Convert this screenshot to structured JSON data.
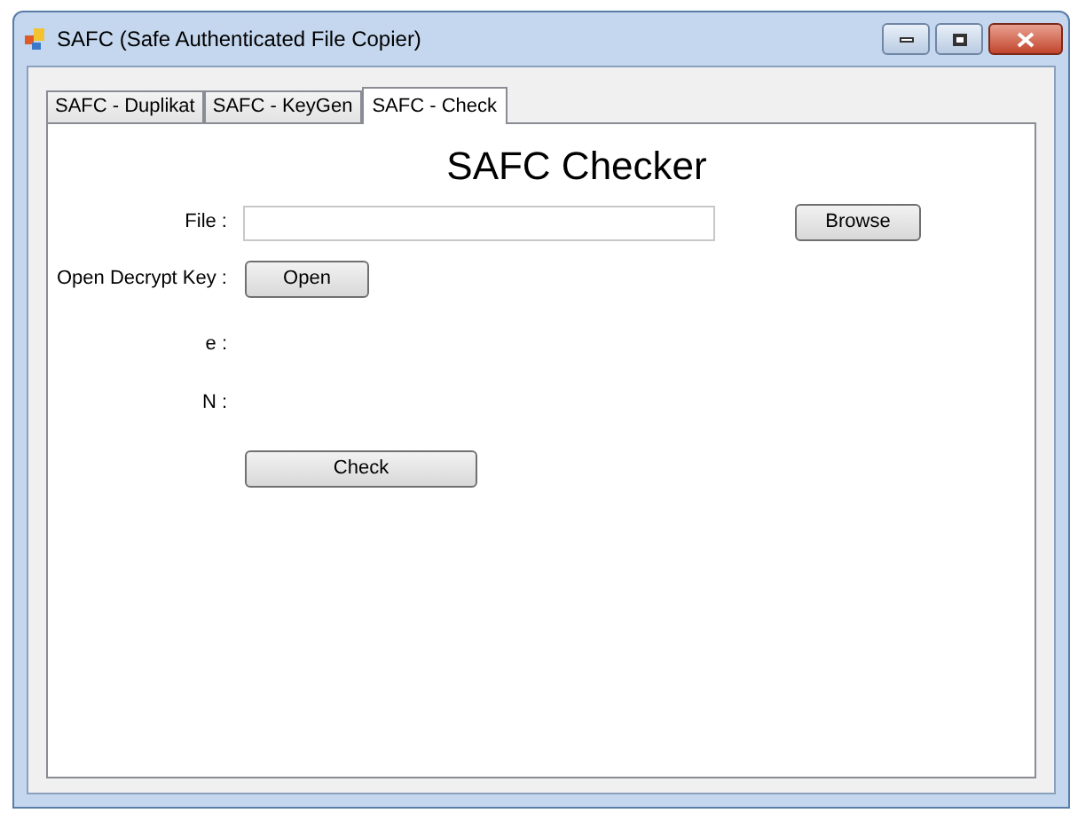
{
  "window": {
    "title": "SAFC (Safe Authenticated File Copier)"
  },
  "tabs": [
    {
      "label": "SAFC - Duplikat",
      "selected": false
    },
    {
      "label": "SAFC - KeyGen",
      "selected": false
    },
    {
      "label": "SAFC - Check",
      "selected": true
    }
  ],
  "heading": "SAFC Checker",
  "file": {
    "label": "File :",
    "button": "Browse"
  },
  "key": {
    "label": "Open Decrypt Key :",
    "button": "Open"
  },
  "fields": [
    {
      "label": "e :"
    },
    {
      "label": "N :"
    }
  ],
  "check_button": "Check"
}
